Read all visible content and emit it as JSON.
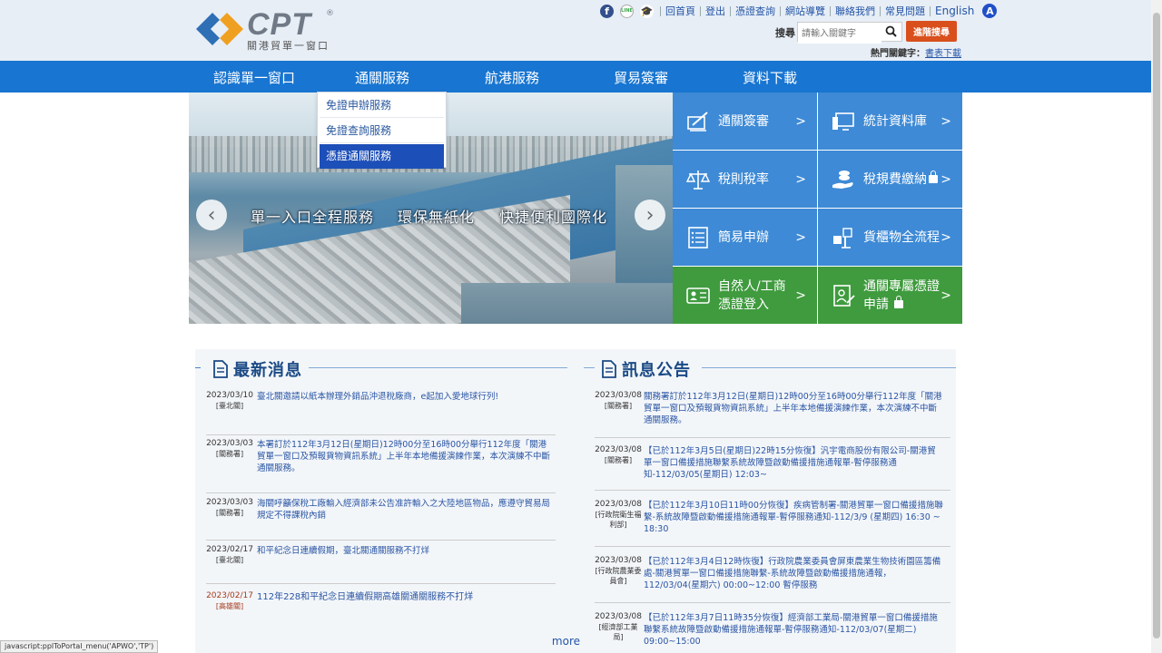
{
  "logo": {
    "text": "CPT",
    "reg": "®",
    "subtitle": "關港貿單一窗口"
  },
  "toplinks": {
    "line_label": "LINE",
    "items": [
      "回首頁",
      "登出",
      "憑證查詢",
      "網站導覽",
      "聯絡我們",
      "常見問題"
    ],
    "english": "English",
    "access": "A"
  },
  "search": {
    "label": "搜尋",
    "placeholder": "請輸入關鍵字",
    "advanced": "進階搜尋"
  },
  "hot_keywords": {
    "label": "熱門關鍵字：",
    "link": "書表下載"
  },
  "nav": [
    "認識單一窗口",
    "通關服務",
    "航港服務",
    "貿易簽審",
    "資料下載"
  ],
  "dropdown": [
    "免證申辦服務",
    "免證查詢服務",
    "憑證通關服務"
  ],
  "banner": {
    "slogans": [
      "單一入口全程服務",
      "環保無紙化",
      "快捷便利國際化"
    ],
    "prev": "‹",
    "next": "›"
  },
  "tiles": [
    {
      "label": "通關簽審",
      "arrow": ">",
      "icon": "customs-review-icon"
    },
    {
      "label": "統計資料庫",
      "arrow": ">",
      "icon": "statistics-database-icon"
    },
    {
      "label": "稅則稅率",
      "arrow": ">",
      "icon": "tariff-scale-icon"
    },
    {
      "label": "稅規費繳納",
      "arrow": ">",
      "icon": "fee-payment-icon"
    },
    {
      "label": "簡易申辦",
      "arrow": ">",
      "icon": "simple-application-icon"
    },
    {
      "label": "貨櫃物全流程",
      "arrow": ">",
      "icon": "container-tracking-icon"
    },
    {
      "label1": "自然人/工商",
      "label2": "憑證登入",
      "arrow": ">",
      "icon": "certificate-login-icon"
    },
    {
      "label1": "通關專屬憑證",
      "label2": "申請",
      "arrow": ">",
      "icon": "certificate-application-icon"
    }
  ],
  "latest_news": {
    "title": "最新消息",
    "items": [
      {
        "date": "2023/03/10",
        "org": "[臺北關]",
        "text": "臺北關邀請以紙本辦理外銷品沖退稅廠商，e起加入愛地球行列!"
      },
      {
        "date": "2023/03/03",
        "org": "[關務署]",
        "text": "本署訂於112年3月12日(星期日)12時00分至16時00分舉行112年度「關港貿單一窗口及預報貨物資訊系統」上半年本地備援演練作業，本次演練不中斷通關服務。"
      },
      {
        "date": "2023/03/03",
        "org": "[關務署]",
        "text": "海關呼籲保稅工廠輸入經濟部未公告准許輸入之大陸地區物品，應遵守貿易局規定不得課稅內銷"
      },
      {
        "date": "2023/02/17",
        "org": "[臺北關]",
        "text": "和平紀念日連續假期，臺北關通關服務不打烊"
      },
      {
        "date": "2023/02/17",
        "org": "[高雄關]",
        "text": "112年228和平紀念日連續假期高雄關通關服務不打烊"
      }
    ],
    "more": "more"
  },
  "announcements": {
    "title": "訊息公告",
    "items": [
      {
        "date": "2023/03/08",
        "org": "[關務署]",
        "text": "關務署訂於112年3月12日(星期日)12時00分至16時00分舉行112年度「關港貿單一窗口及預報貨物資訊系統」上半年本地備援演練作業，本次演練不中斷通關服務。"
      },
      {
        "date": "2023/03/08",
        "org": "[關務署]",
        "text": "【已於112年3月5日(星期日)22時15分恢復】汎宇電商股份有限公司-關港貿單一窗口備援措施聯繫系統故障暨啟動備援措施通報單-暫停服務通知-112/03/05(星期日) 12:03~"
      },
      {
        "date": "2023/03/08",
        "org": "[行政院衛生福利部]",
        "text": "【已於112年3月10日11時00分恢復】疾病管制署-關港貿單一窗口備援措施聯繫-系統故障暨啟動備援措施通報單-暫停服務通知-112/3/9 (星期四) 16:30 ~ 18:30"
      },
      {
        "date": "2023/03/08",
        "org": "[行政院農業委員會]",
        "text": "【已於112年3月4日12時恢復】行政院農業委員會屏東農業生物技術園區籌備處-關港貿單一窗口備援措施聯繫-系統故障暨啟動備援措施通報，112/03/04(星期六) 00:00~12:00 暫停服務"
      },
      {
        "date": "2023/03/08",
        "org": "[經濟部工業局]",
        "text": "【已於112年3月7日11時35分恢復】經濟部工業局-關港貿單一窗口備援措施聯繫系統故障暨啟動備援措施通報單-暫停服務通知-112/03/07(星期二) 09:00~15:00"
      }
    ]
  },
  "status_bar": "javascript:pplToPortal_menu('APWO','TP')",
  "colors": {
    "nav": "#1875d1",
    "tile_blue": "#3e8ad6",
    "tile_green": "#3f9b3e",
    "accent_orange": "#d9501d"
  }
}
